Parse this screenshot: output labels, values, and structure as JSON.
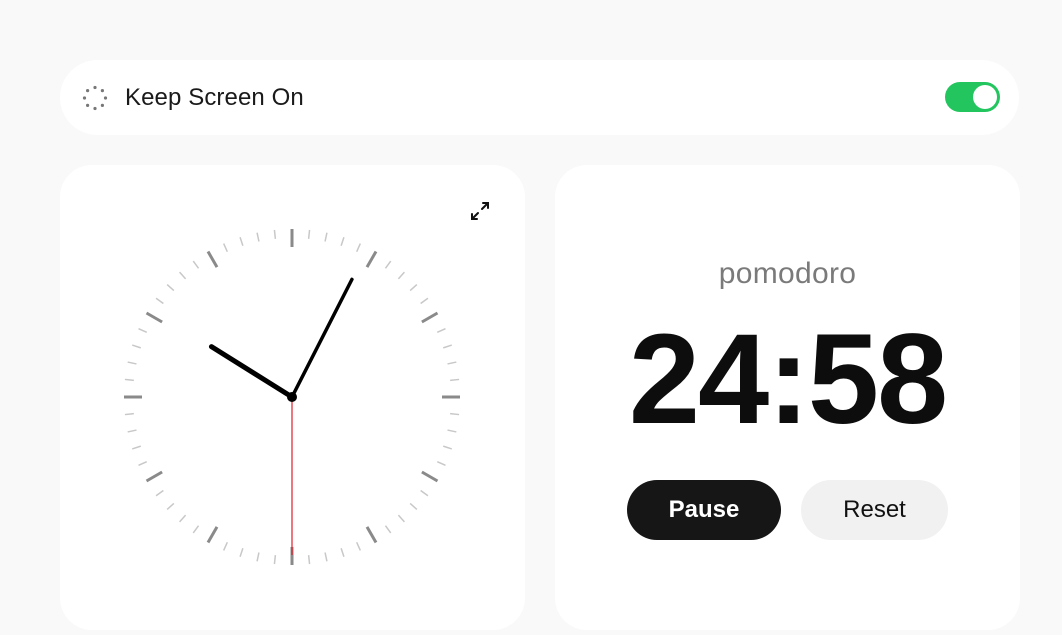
{
  "header": {
    "keep_screen_on_label": "Keep Screen On",
    "keep_screen_on_enabled": true,
    "accent_color": "#22c55e"
  },
  "clock": {
    "time_shown": "10:04:30",
    "second_hand_color": "#e11d2a",
    "expand_icon": "expand-icon"
  },
  "timer": {
    "mode": "pomodoro",
    "remaining": "24:58",
    "pause_label": "Pause",
    "reset_label": "Reset"
  }
}
